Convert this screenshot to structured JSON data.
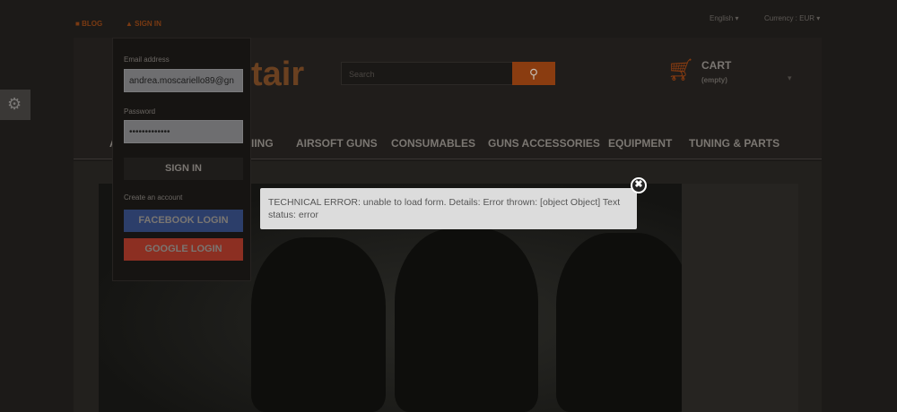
{
  "topbar": {
    "blog": "BLOG",
    "sign_in": "SIGN IN",
    "language": "English",
    "currency": "Currency : EUR"
  },
  "logo": {
    "text": "tair"
  },
  "search": {
    "placeholder": "Search"
  },
  "cart": {
    "title": "CART",
    "status": "(empty)"
  },
  "nav": {
    "items": [
      "A",
      "IING",
      "AIRSOFT GUNS",
      "CONSUMABLES",
      "GUNS ACCESSORIES",
      "EQUIPMENT",
      "TUNING & PARTS"
    ]
  },
  "login": {
    "email_label": "Email address",
    "email_value": "andrea.moscariello89@gn",
    "password_label": "Password",
    "password_value": "•••••••••••••",
    "sign_in": "SIGN IN",
    "create": "Create an account",
    "facebook": "FACEBOOK LOGIN",
    "google": "GOOGLE LOGIN"
  },
  "error": {
    "message": "TECHNICAL ERROR: unable to load form. Details: Error thrown: [object Object] Text status: error",
    "close": "✖"
  },
  "colors": {
    "accent": "#c4540f",
    "facebook": "#2c3e6a",
    "google": "#8c2f22"
  }
}
